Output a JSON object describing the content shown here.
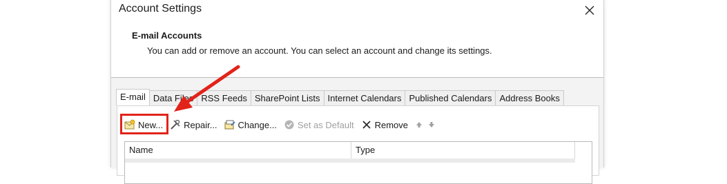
{
  "dialog": {
    "title": "Account Settings",
    "close_label": "Close"
  },
  "header": {
    "title": "E-mail Accounts",
    "description": "You can add or remove an account. You can select an account and change its settings."
  },
  "tabs": [
    {
      "label": "E-mail",
      "active": true
    },
    {
      "label": "Data Files",
      "active": false
    },
    {
      "label": "RSS Feeds",
      "active": false
    },
    {
      "label": "SharePoint Lists",
      "active": false
    },
    {
      "label": "Internet Calendars",
      "active": false
    },
    {
      "label": "Published Calendars",
      "active": false
    },
    {
      "label": "Address Books",
      "active": false
    }
  ],
  "toolbar": {
    "new_label": "New...",
    "repair_label": "Repair...",
    "change_label": "Change...",
    "set_default_label": "Set as Default",
    "remove_label": "Remove"
  },
  "list": {
    "columns": [
      "Name",
      "Type"
    ]
  },
  "colors": {
    "annotation_red": "#e2231a",
    "tab_inactive_bg": "#f0f0f0",
    "body_bg": "#f3f3f3"
  }
}
